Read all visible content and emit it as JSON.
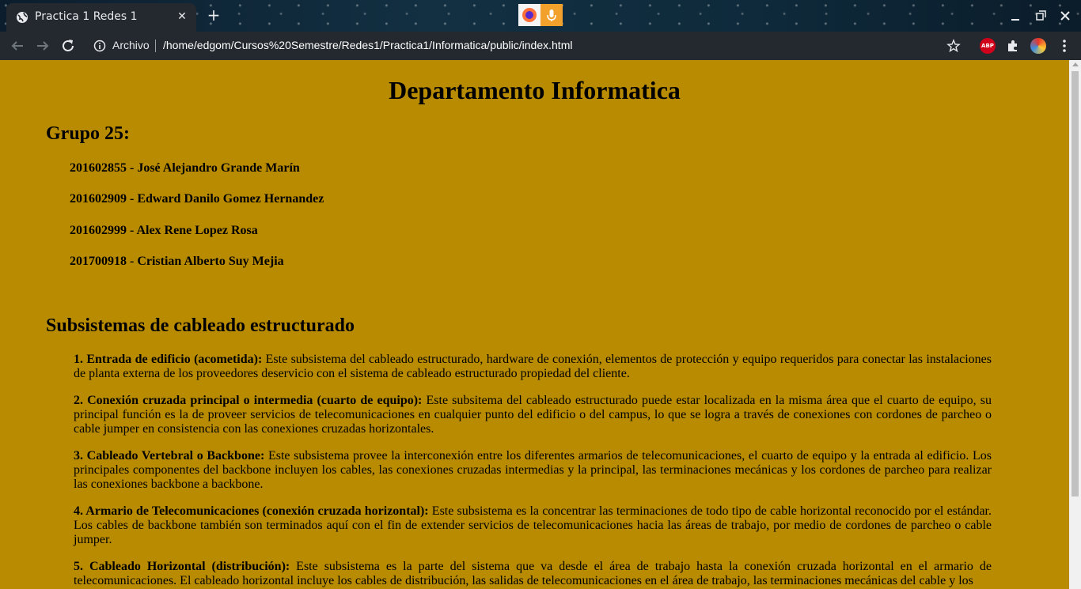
{
  "browser": {
    "tab_title": "Practica 1 Redes 1",
    "new_tab_symbol": "+",
    "close_symbol": "✕",
    "scheme_label": "Archivo",
    "url": "/home/edgom/Cursos%20Semestre/Redes1/Practica1/Informatica/public/index.html",
    "abp_label": "ABP",
    "icons": [
      "globe-icon",
      "close-icon",
      "plus-icon",
      "firefox-icon",
      "microphone-icon",
      "minimize-icon",
      "maximize-icon",
      "window-close-icon",
      "back-arrow-icon",
      "forward-arrow-icon",
      "reload-icon",
      "info-icon",
      "star-icon",
      "abp-icon",
      "puzzle-icon",
      "profile-avatar-icon",
      "kebab-menu-icon"
    ]
  },
  "page": {
    "title": "Departamento Informatica",
    "group_heading": "Grupo 25:",
    "members": [
      "201602855 - José Alejandro Grande Marín",
      "201602909 - Edward Danilo Gomez Hernandez",
      "201602999 - Alex Rene Lopez Rosa",
      "201700918 - Cristian Alberto Suy Mejia"
    ],
    "subsystems_heading": "Subsistemas de cableado estructurado",
    "subsystems": [
      {
        "title": "1. Entrada de edificio (acometida):",
        "text": " Este subsistema del cableado estructurado, hardware de conexión, elementos de protección y equipo requeridos para conectar las instalaciones de planta externa de los proveedores deservicio con el sistema de cableado estructurado propiedad del cliente."
      },
      {
        "title": "2. Conexión cruzada principal o intermedia (cuarto de equipo):",
        "text": " Este subsitema del cableado estructurado puede estar localizada en la misma área que el cuarto de equipo, su principal función es la de proveer servicios de telecomunicaciones en cualquier punto del edificio o del campus, lo que se logra a través de conexiones con cordones de parcheo o cable jumper en consistencia con las conexiones cruzadas horizontales."
      },
      {
        "title": "3. Cableado Vertebral o Backbone:",
        "text": " Este subsistema provee la interconexión entre los diferentes armarios de telecomunicaciones, el cuarto de equipo y la entrada al edificio. Los principales componentes del backbone incluyen los cables, las conexiones cruzadas intermedias y la principal, las terminaciones mecánicas y los cordones de parcheo para realizar las conexiones backbone a backbone."
      },
      {
        "title": "4. Armario de Telecomunicaciones (conexión cruzada horizontal):",
        "text": " Este subsistema es la concentrar las terminaciones de todo tipo de cable horizontal reconocido por el estándar. Los cables de backbone también son terminados aquí con el fin de extender servicios de telecomunicaciones hacia las áreas de trabajo, por medio de cordones de parcheo o cable jumper."
      },
      {
        "title": "5. Cableado Horizontal (distribución):",
        "text": " Este subsistema es la parte del sistema que va desde el área de trabajo hasta la conexión cruzada horizontal en el armario de telecomunicaciones. El cableado horizontal incluye los cables de distribución, las salidas de telecomunicaciones en el área de trabajo, las terminaciones mecánicas del cable y los"
      }
    ]
  },
  "colors": {
    "page_background": "#b98b00",
    "chrome_dark": "#24292f",
    "text": "#000000"
  }
}
